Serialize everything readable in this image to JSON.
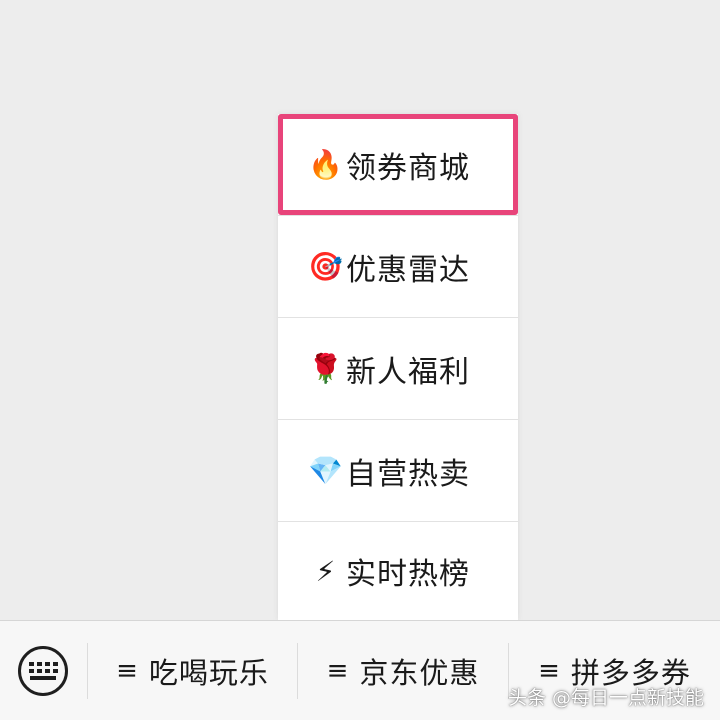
{
  "submenu": {
    "items": [
      {
        "icon": "🔥",
        "icon_name": "fire-icon",
        "label": "领券商城",
        "selected": true
      },
      {
        "icon": "🎯",
        "icon_name": "target-icon",
        "label": "优惠雷达"
      },
      {
        "icon": "🌹",
        "icon_name": "rose-icon",
        "label": "新人福利"
      },
      {
        "icon": "💎",
        "icon_name": "diamond-icon",
        "label": "自营热卖"
      },
      {
        "icon": "⚡",
        "icon_name": "lightning-icon",
        "label": "实时热榜"
      }
    ],
    "highlight_color": "#e8447a"
  },
  "bottom_bar": {
    "keyboard_icon": "keyboard-icon",
    "tabs": [
      {
        "icon": "≡",
        "label": "吃喝玩乐"
      },
      {
        "icon": "≡",
        "label": "京东优惠"
      },
      {
        "icon": "≡",
        "label": "拼多多券"
      }
    ]
  },
  "watermark": "头条 @每日一点新技能"
}
